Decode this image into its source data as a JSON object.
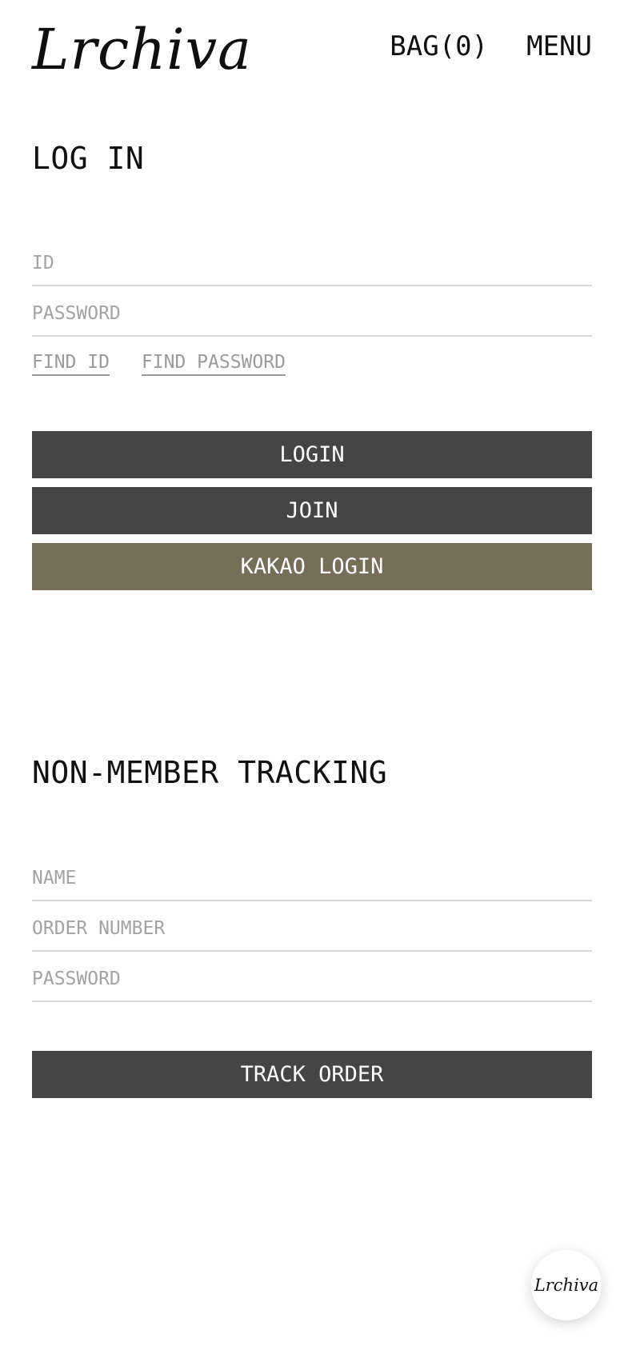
{
  "header": {
    "logo_text": "Lrchiva",
    "bag_label": "BAG(0)",
    "menu_label": "MENU"
  },
  "login": {
    "title": "LOG IN",
    "id_placeholder": "ID",
    "password_placeholder": "PASSWORD",
    "find_id_label": "FIND ID",
    "find_password_label": "FIND PASSWORD",
    "login_button_label": "LOGIN",
    "join_button_label": "JOIN",
    "kakao_button_label": "KAKAO LOGIN"
  },
  "tracking": {
    "title": "NON-MEMBER TRACKING",
    "name_placeholder": "NAME",
    "order_number_placeholder": "ORDER NUMBER",
    "password_placeholder": "PASSWORD",
    "track_button_label": "TRACK ORDER"
  },
  "floating_button": {
    "logo_text": "Lrchiva"
  },
  "colors": {
    "dark_button": "#454545",
    "kakao_button": "#776e5a",
    "placeholder": "#a3a3a3",
    "divider": "#d8d8d8"
  }
}
